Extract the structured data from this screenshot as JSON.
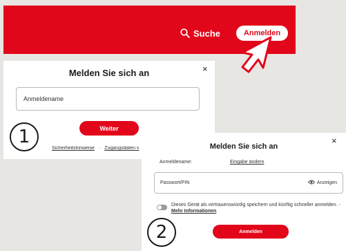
{
  "header": {
    "search_label": "Suche",
    "login_label": "Anmelden",
    "brand_color": "#e2061a"
  },
  "step1": {
    "number": "1",
    "title": "Melden Sie sich an",
    "close_symbol": "×",
    "username_placeholder": "Anmeldename",
    "continue_label": "Weiter",
    "footer_links": [
      "Sicherheitshinweise",
      "Zugangsdaten v"
    ],
    "footer_separator": "·"
  },
  "step2": {
    "number": "2",
    "title": "Melden Sie sich an",
    "close_symbol": "×",
    "username_label": "Anmeldename:",
    "change_input_link": "Eingabe ändern",
    "password_placeholder": "Passwort/PIN",
    "show_password_label": "Anzeigen",
    "trust_device_text": "Dieses Gerät als vertrauenswürdig speichern und künftig schneller anmelden. -",
    "more_info_link": "Mehr Informationen",
    "login_label": "Anmelden"
  },
  "icons": {
    "search": "search-icon",
    "cursor": "hand-pointer-icon",
    "eye": "eye-icon",
    "toggle": "toggle-off-icon"
  }
}
